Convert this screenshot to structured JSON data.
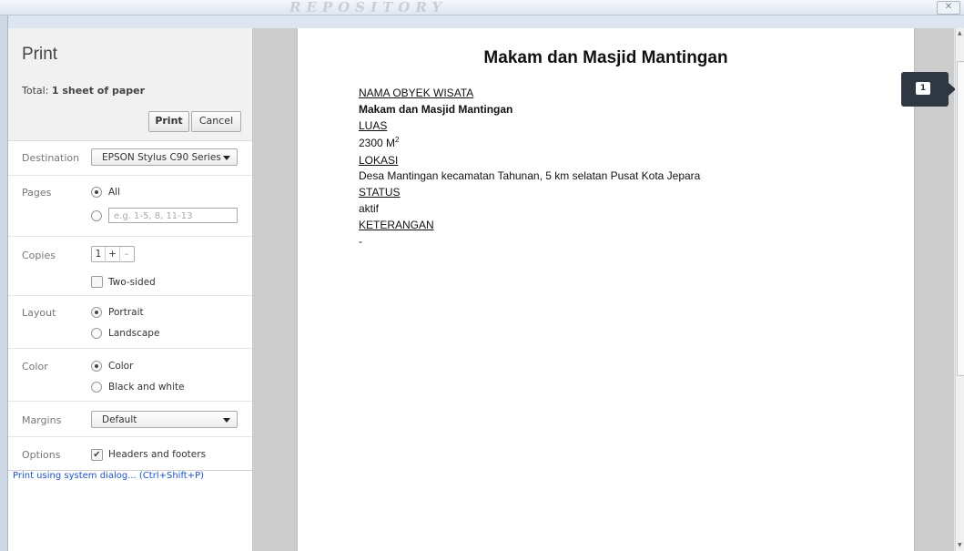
{
  "window": {
    "close_label": "✕",
    "watermark_text": "REPOSITORY"
  },
  "sidebar": {
    "title": "Print",
    "summary_prefix": "Total: ",
    "summary_value": "1 sheet of paper",
    "print_label": "Print",
    "cancel_label": "Cancel",
    "destination": {
      "label": "Destination",
      "value": "EPSON Stylus C90 Series"
    },
    "pages": {
      "label": "Pages",
      "all_label": "All",
      "range_placeholder": "e.g. 1-5, 8, 11-13",
      "selected": "All"
    },
    "copies": {
      "label": "Copies",
      "value": "1",
      "plus": "+",
      "minus": "–",
      "two_sided_label": "Two-sided",
      "two_sided_checked": false
    },
    "layout": {
      "label": "Layout",
      "portrait": "Portrait",
      "landscape": "Landscape",
      "selected": "Portrait"
    },
    "color": {
      "label": "Color",
      "color": "Color",
      "bw": "Black and white",
      "selected": "Color"
    },
    "margins": {
      "label": "Margins",
      "value": "Default"
    },
    "options": {
      "label": "Options",
      "headers_footers_label": "Headers and footers",
      "headers_footers_checked": true
    },
    "system_dialog_link": "Print using system dialog... (Ctrl+Shift+P)"
  },
  "preview": {
    "page_number": "1",
    "document": {
      "title": "Makam dan Masjid Mantingan",
      "lines": [
        {
          "text": "NAMA OBYEK WISATA",
          "style": "u"
        },
        {
          "text": "Makam dan Masjid Mantingan",
          "style": "b"
        },
        {
          "text": "LUAS",
          "style": "u"
        },
        {
          "text": "2300 M",
          "sup": "2",
          "style": ""
        },
        {
          "text": "LOKASI",
          "style": "u"
        },
        {
          "text": "Desa Mantingan kecamatan Tahunan, 5 km selatan Pusat Kota Jepara",
          "style": ""
        },
        {
          "text": "STATUS",
          "style": "u"
        },
        {
          "text": "aktif",
          "style": ""
        },
        {
          "text": "KETERANGAN",
          "style": "u"
        },
        {
          "text": "-",
          "style": ""
        }
      ]
    }
  },
  "colors": {
    "link": "#1a55c7",
    "badge": "#2f3742",
    "preview_bg": "#cccccc"
  }
}
